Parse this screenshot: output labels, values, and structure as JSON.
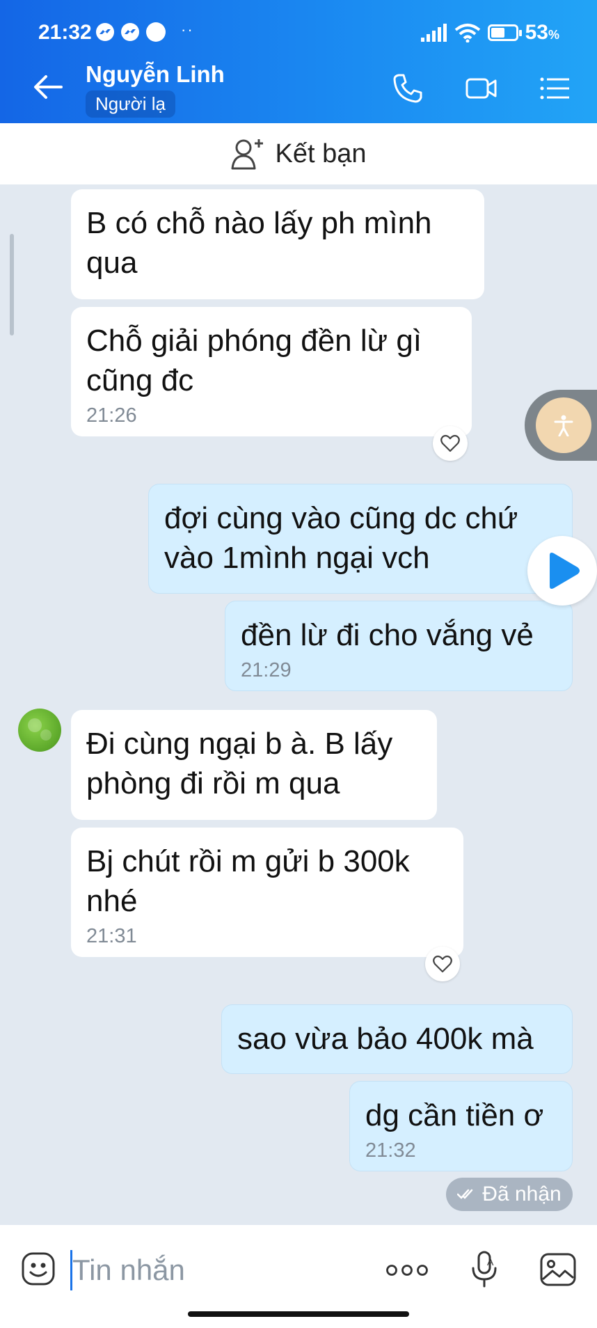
{
  "status_bar": {
    "time": "21:32",
    "battery_percent": "53",
    "battery_unit": "%"
  },
  "header": {
    "contact_name": "Nguyễn Linh",
    "contact_tag": "Người lạ"
  },
  "add_friend": {
    "label": "Kết bạn"
  },
  "messages": [
    {
      "direction": "in",
      "text": "B có chỗ nào lấy ph mình\nqua",
      "time": ""
    },
    {
      "direction": "in",
      "text": "Chỗ giải phóng đền lừ gì\ncũng đc",
      "time": "21:26"
    },
    {
      "direction": "out",
      "text": "đợi cùng vào cũng dc chứ\nvào 1mình ngại vch",
      "time": ""
    },
    {
      "direction": "out",
      "text": "đền lừ đi cho vắng vẻ",
      "time": "21:29"
    },
    {
      "direction": "in",
      "text": "Đi cùng ngại b à. B lấy\nphòng đi rồi m qua",
      "time": ""
    },
    {
      "direction": "in",
      "text": "Bj chút rồi m gửi b 300k\nnhé",
      "time": "21:31"
    },
    {
      "direction": "out",
      "text": "sao vừa bảo 400k mà",
      "time": ""
    },
    {
      "direction": "out",
      "text": "dg cần tiền ơ",
      "time": "21:32"
    }
  ],
  "delivery_status": "Đã nhận",
  "input": {
    "placeholder": "Tin nhắn",
    "value": ""
  },
  "icons": [
    "messenger-icon",
    "wifi-icon",
    "signal-icon",
    "battery-icon",
    "back-arrow-icon",
    "phone-icon",
    "video-call-icon",
    "menu-icon",
    "add-friend-icon",
    "heart-icon",
    "accessibility-icon",
    "play-icon",
    "double-check-icon",
    "emoji-icon",
    "more-icon",
    "voice-icon",
    "image-icon"
  ],
  "colors": {
    "header_start": "#1466e6",
    "header_end": "#22a4f6",
    "chat_bg": "#e2e9f1",
    "outgoing_bubble": "#d5efff",
    "incoming_bubble": "#ffffff"
  }
}
